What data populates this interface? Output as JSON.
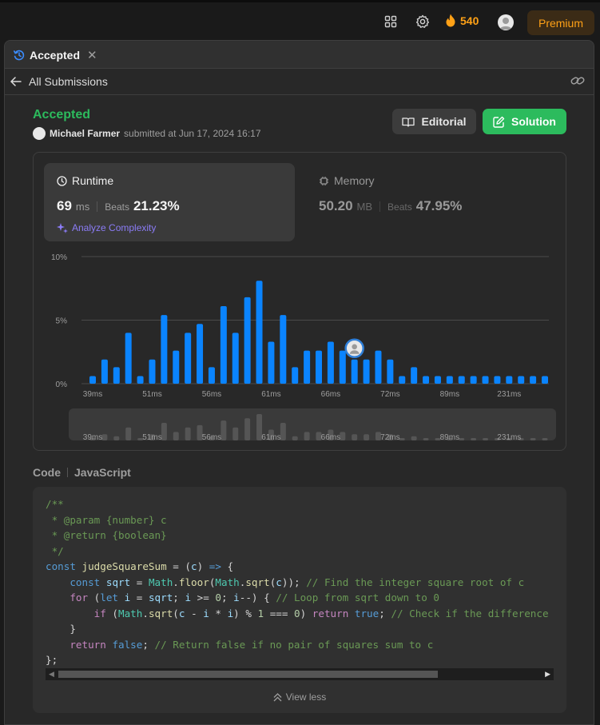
{
  "topbar": {
    "streak_count": "540",
    "premium_label": "Premium"
  },
  "tab": {
    "label": "Accepted"
  },
  "subbar": {
    "back_label": "All Submissions"
  },
  "submission": {
    "status": "Accepted",
    "user_name": "Michael Farmer",
    "submitted_text": "submitted at Jun 17, 2024 16:17",
    "editorial_label": "Editorial",
    "solution_label": "Solution"
  },
  "runtime": {
    "title": "Runtime",
    "value": "69",
    "unit": "ms",
    "beats_label": "Beats",
    "beats_value": "21.23%",
    "analyze_label": "Analyze Complexity"
  },
  "memory": {
    "title": "Memory",
    "value": "50.20",
    "unit": "MB",
    "beats_label": "Beats",
    "beats_value": "47.95%"
  },
  "chart_data": {
    "type": "bar",
    "ylim": [
      0,
      10
    ],
    "y_ticks": [
      "10%",
      "5%",
      "0%"
    ],
    "x_tick_labels": [
      "39ms",
      "51ms",
      "56ms",
      "61ms",
      "66ms",
      "72ms",
      "89ms",
      "231ms"
    ],
    "values": [
      0.6,
      1.9,
      1.3,
      4.0,
      0.6,
      1.9,
      5.4,
      2.6,
      4.0,
      4.7,
      1.3,
      6.1,
      4.0,
      6.8,
      8.1,
      3.3,
      5.4,
      1.3,
      2.6,
      2.6,
      3.3,
      2.6,
      1.9,
      1.9,
      2.6,
      1.9,
      0.6,
      1.3,
      0.6,
      0.6,
      0.6,
      0.6,
      0.6,
      0.6,
      0.6,
      0.6,
      0.6,
      0.6,
      0.6
    ],
    "user_bar_index": 22,
    "bar_color": "#0a84ff",
    "grid": true
  },
  "code": {
    "label": "Code",
    "language": "JavaScript",
    "view_less_label": "View less"
  }
}
